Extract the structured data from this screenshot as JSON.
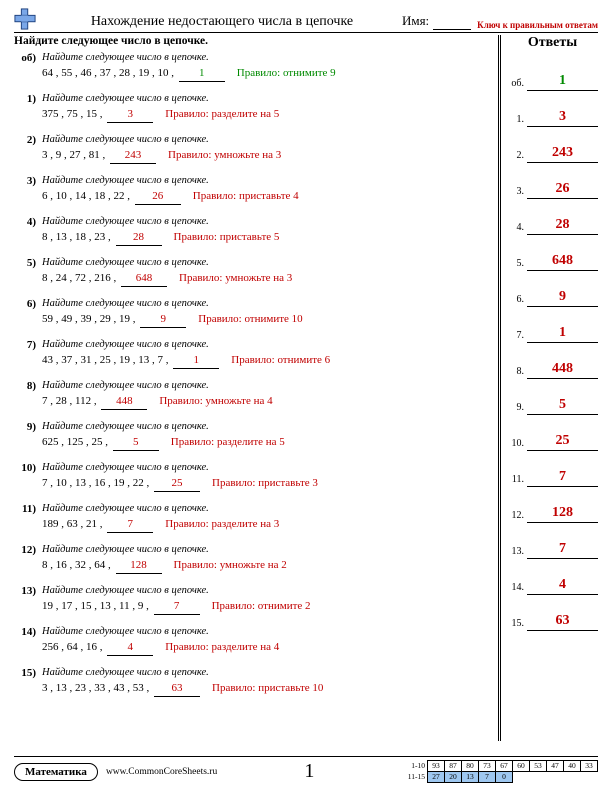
{
  "header": {
    "title": "Нахождение недостающего числа в цепочке",
    "name_label": "Имя:",
    "key_label": "Ключ к правильным ответам"
  },
  "instructions": "Найдите следующее число в цепочке.",
  "answers_title": "Ответы",
  "prompt_text": "Найдите следующее число в цепочке.",
  "rule_prefix": "Правило:",
  "problems": [
    {
      "num": "об)",
      "sequence": "64 , 55 , 46 , 37 , 28 , 19 , 10 ,",
      "answer": "1",
      "rule": "отнимите 9",
      "is_example": true
    },
    {
      "num": "1)",
      "sequence": "375 , 75 , 15 ,",
      "answer": "3",
      "rule": "разделите на 5"
    },
    {
      "num": "2)",
      "sequence": "3 , 9 , 27 , 81 ,",
      "answer": "243",
      "rule": "умножьте на 3"
    },
    {
      "num": "3)",
      "sequence": "6 , 10 , 14 , 18 , 22 ,",
      "answer": "26",
      "rule": "приставьте 4"
    },
    {
      "num": "4)",
      "sequence": "8 , 13 , 18 , 23 ,",
      "answer": "28",
      "rule": "приставьте 5"
    },
    {
      "num": "5)",
      "sequence": "8 , 24 , 72 , 216 ,",
      "answer": "648",
      "rule": "умножьте на 3"
    },
    {
      "num": "6)",
      "sequence": "59 , 49 , 39 , 29 , 19 ,",
      "answer": "9",
      "rule": "отнимите 10"
    },
    {
      "num": "7)",
      "sequence": "43 , 37 , 31 , 25 , 19 , 13 , 7 ,",
      "answer": "1",
      "rule": "отнимите 6"
    },
    {
      "num": "8)",
      "sequence": "7 , 28 , 112 ,",
      "answer": "448",
      "rule": "умножьте на 4"
    },
    {
      "num": "9)",
      "sequence": "625 , 125 , 25 ,",
      "answer": "5",
      "rule": "разделите на 5"
    },
    {
      "num": "10)",
      "sequence": "7 , 10 , 13 , 16 , 19 , 22 ,",
      "answer": "25",
      "rule": "приставьте 3"
    },
    {
      "num": "11)",
      "sequence": "189 , 63 , 21 ,",
      "answer": "7",
      "rule": "разделите на 3"
    },
    {
      "num": "12)",
      "sequence": "8 , 16 , 32 , 64 ,",
      "answer": "128",
      "rule": "умножьте на 2"
    },
    {
      "num": "13)",
      "sequence": "19 , 17 , 15 , 13 , 11 , 9 ,",
      "answer": "7",
      "rule": "отнимите 2"
    },
    {
      "num": "14)",
      "sequence": "256 , 64 , 16 ,",
      "answer": "4",
      "rule": "разделите на 4"
    },
    {
      "num": "15)",
      "sequence": "3 , 13 , 23 , 33 , 43 , 53 ,",
      "answer": "63",
      "rule": "приставьте 10"
    }
  ],
  "answers": [
    {
      "label": "об.",
      "value": "1",
      "is_example": true
    },
    {
      "label": "1.",
      "value": "3"
    },
    {
      "label": "2.",
      "value": "243"
    },
    {
      "label": "3.",
      "value": "26"
    },
    {
      "label": "4.",
      "value": "28"
    },
    {
      "label": "5.",
      "value": "648"
    },
    {
      "label": "6.",
      "value": "9"
    },
    {
      "label": "7.",
      "value": "1"
    },
    {
      "label": "8.",
      "value": "448"
    },
    {
      "label": "9.",
      "value": "5"
    },
    {
      "label": "10.",
      "value": "25"
    },
    {
      "label": "11.",
      "value": "7"
    },
    {
      "label": "12.",
      "value": "128"
    },
    {
      "label": "13.",
      "value": "7"
    },
    {
      "label": "14.",
      "value": "4"
    },
    {
      "label": "15.",
      "value": "63"
    }
  ],
  "footer": {
    "subject": "Математика",
    "site": "www.CommonCoreSheets.ru",
    "page_number": "1",
    "score_rows": [
      {
        "label": "1-10",
        "cells": [
          "93",
          "87",
          "80",
          "73",
          "67",
          "60",
          "53",
          "47",
          "40",
          "33"
        ],
        "hl": []
      },
      {
        "label": "11-15",
        "cells": [
          "27",
          "20",
          "13",
          "7",
          "0",
          "",
          "",
          "",
          "",
          ""
        ],
        "hl": [
          0,
          1,
          2,
          3,
          4
        ]
      }
    ]
  }
}
